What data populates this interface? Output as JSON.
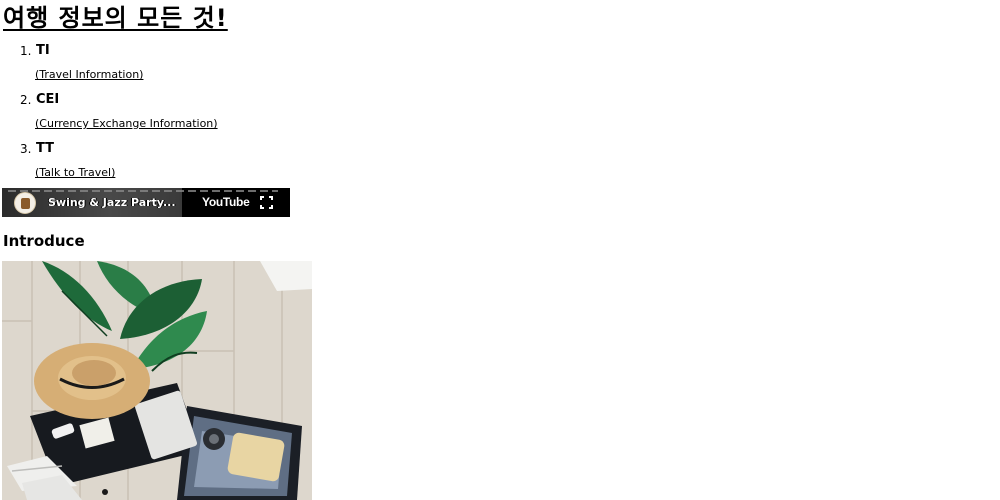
{
  "header": {
    "title": "여행 정보의 모든 것!"
  },
  "nav": {
    "items": [
      {
        "number": "1.",
        "abbr": "TI",
        "link_text": "(Travel Information)"
      },
      {
        "number": "2.",
        "abbr": "CEI",
        "link_text": "(Currency Exchange Information)"
      },
      {
        "number": "3.",
        "abbr": "TT",
        "link_text": "(Talk to Travel)"
      }
    ]
  },
  "video": {
    "title": "Swing & Jazz Party...",
    "platform_label": "YouTube",
    "icons": [
      "channel-avatar",
      "share-icon",
      "youtube-logo",
      "fullscreen-icon"
    ]
  },
  "intro": {
    "heading": "Introduce",
    "image_subject": "open suitcase with straw hat, camera and tropical leaves on wooden floor"
  },
  "colors": {
    "text": "#000000",
    "background": "#ffffff",
    "video_bar": "#000000",
    "floor": "#dcd6cc",
    "leaf": "#1f6b3a",
    "suitcase": "#1a1d22",
    "hat": "#d8b27a"
  }
}
